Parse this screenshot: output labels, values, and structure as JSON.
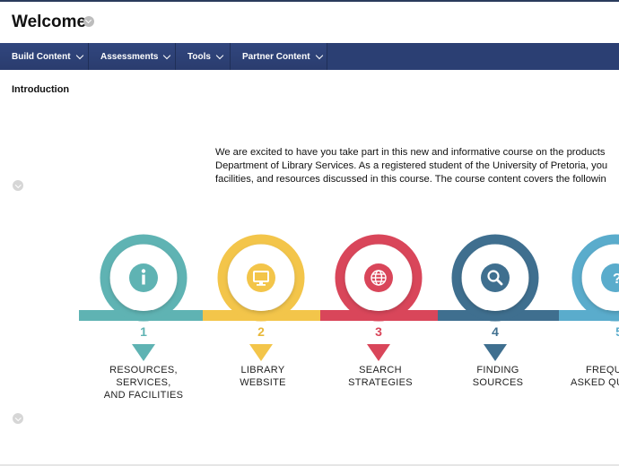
{
  "page": {
    "title": "Welcome"
  },
  "menu": [
    {
      "label": "Build Content"
    },
    {
      "label": "Assessments"
    },
    {
      "label": "Tools"
    },
    {
      "label": "Partner Content"
    }
  ],
  "section": {
    "title": "Introduction"
  },
  "intro_lines": [
    "We are excited to have you take part in this new and informative course on the products",
    "Department of Library Services. As a registered student of the University of Pretoria, you",
    "facilities, and resources discussed in this course. The course content covers the followin"
  ],
  "steps": [
    {
      "number": "1",
      "line1": "RESOURCES, SERVICES,",
      "line2": "AND FACILITIES",
      "icon": "info-icon",
      "color": "#5fb3b3"
    },
    {
      "number": "2",
      "line1": "LIBRARY",
      "line2": "WEBSITE",
      "icon": "monitor-icon",
      "color": "#f3c54a"
    },
    {
      "number": "3",
      "line1": "SEARCH",
      "line2": "STRATEGIES",
      "icon": "globe-icon",
      "color": "#d9465a"
    },
    {
      "number": "4",
      "line1": "FINDING",
      "line2": "SOURCES",
      "icon": "search-icon",
      "color": "#3f6f8f"
    },
    {
      "number": "5",
      "line1": "FREQU",
      "line2": "ASKED QU",
      "icon": "question-icon",
      "color": "#5aaccc"
    }
  ]
}
